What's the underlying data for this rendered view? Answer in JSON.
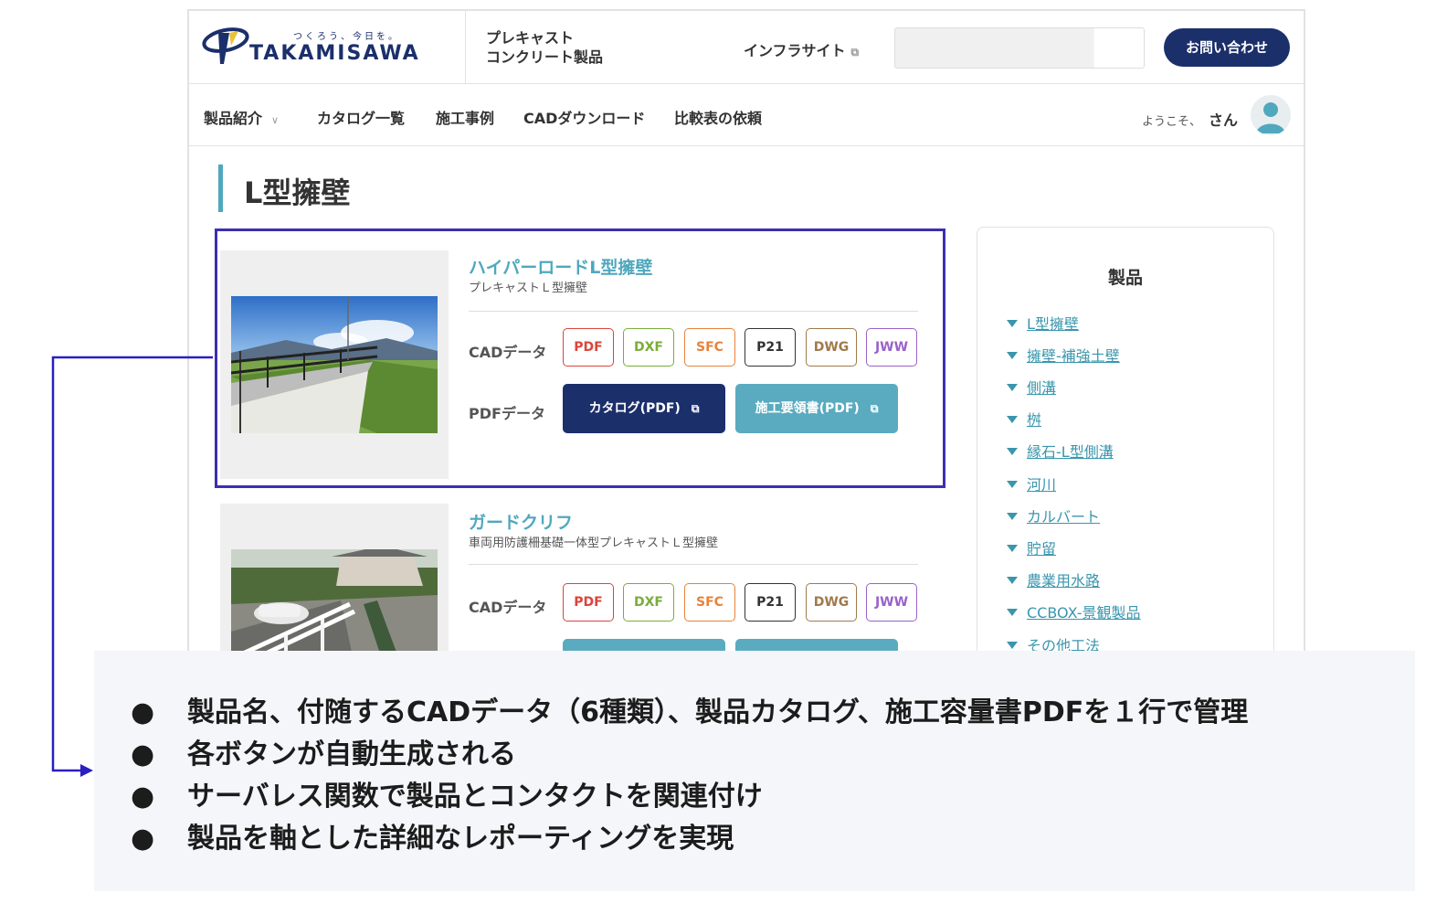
{
  "header": {
    "logo_tagline": "つくろう、今日を。",
    "logo_word": "TAKAMISAWA",
    "subtitle_line1": "プレキャスト",
    "subtitle_line2": "コンクリート製品",
    "infra_link": "インフラサイト",
    "ext_icon": "external-link-icon",
    "contact_button": "お問い合わせ"
  },
  "nav": {
    "items": [
      {
        "label": "製品紹介"
      },
      {
        "label": "カタログ一覧"
      },
      {
        "label": "施工事例"
      },
      {
        "label": "CADダウンロード"
      },
      {
        "label": "比較表の依頼"
      }
    ],
    "welcome_prefix": "ようこそ、",
    "welcome_name": "さん"
  },
  "page": {
    "title": "L型擁壁",
    "accent_color": "#4fa8bd",
    "brand_color": "#1b2f6b"
  },
  "products": [
    {
      "name": "ハイパーロードL型擁壁",
      "subtitle": "プレキャストＬ型擁壁",
      "cad_label": "CADデータ",
      "pdf_label": "PDFデータ",
      "catalog_button": "カタログ(PDF)",
      "manual_button": "施工要領書(PDF)"
    },
    {
      "name": "ガードクリフ",
      "subtitle": "車両用防護柵基礎一体型プレキャストＬ型擁壁",
      "cad_label": "CADデータ"
    }
  ],
  "cad_formats": [
    {
      "label": "PDF",
      "color": "#d9453a"
    },
    {
      "label": "DXF",
      "color": "#7aad3a"
    },
    {
      "label": "SFC",
      "color": "#e8823a"
    },
    {
      "label": "P21",
      "color": "#333333"
    },
    {
      "label": "DWG",
      "color": "#a07a4a"
    },
    {
      "label": "JWW",
      "color": "#9a62c8"
    }
  ],
  "sidebar": {
    "title": "製品",
    "items": [
      {
        "label": "L型擁壁"
      },
      {
        "label": "擁壁-補強土壁"
      },
      {
        "label": "側溝"
      },
      {
        "label": "桝"
      },
      {
        "label": "縁石-L型側溝"
      },
      {
        "label": "河川"
      },
      {
        "label": "カルバート"
      },
      {
        "label": "貯留"
      },
      {
        "label": "農業用水路"
      },
      {
        "label": "CCBOX-景観製品"
      },
      {
        "label": "その他工法"
      }
    ]
  },
  "callout": {
    "bullets": [
      "製品名、付随するCADデータ（6種類）、製品カタログ、施工容量書PDFを１行で管理",
      "各ボタンが自動生成される",
      "サーバレス関数で製品とコンタクトを関連付け",
      "製品を軸とした詳細なレポーティングを実現"
    ]
  }
}
